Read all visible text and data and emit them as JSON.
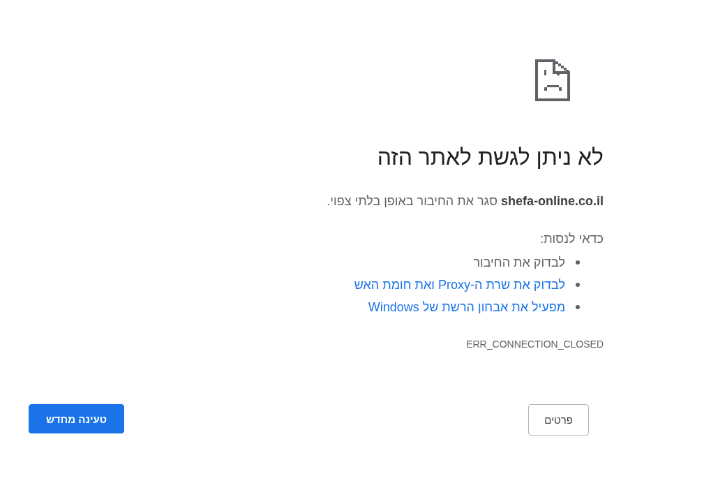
{
  "heading": "לא ניתן לגשת לאתר הזה",
  "message": "**shefa-online.co.il** סגר את החיבור באופן בלתי צפוי.",
  "suggestions": {
    "title": "כדאי לנסות:",
    "items": [
      {
        "kind": "text",
        "label": "לבדוק את החיבור"
      },
      {
        "kind": "link",
        "label": "לבדוק את שרת ה-Proxy ואת חומת האש"
      },
      {
        "kind": "link",
        "label": "מפעיל את אבחון הרשת של Windows"
      }
    ]
  },
  "error_code": "ERR_CONNECTION_CLOSED",
  "buttons": [
    {
      "kind": "secondary",
      "label": "פרטים"
    },
    {
      "kind": "primary",
      "label": "טעינה מחדש"
    }
  ]
}
